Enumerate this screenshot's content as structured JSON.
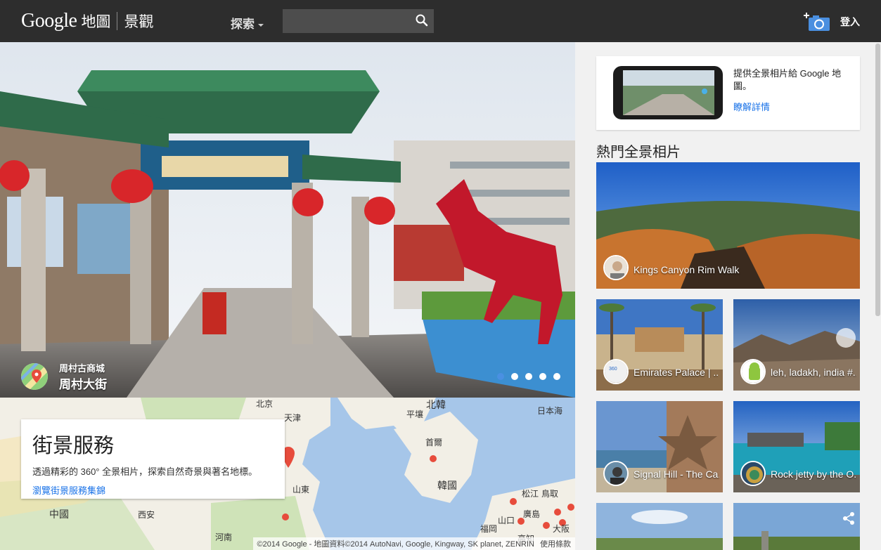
{
  "header": {
    "logo_google": "Google",
    "logo_maps": "地圖",
    "logo_views": "景觀",
    "explore_label": "探索",
    "search_placeholder": "",
    "signin_label": "登入"
  },
  "hero": {
    "place_sub": "周村古商城",
    "place_main": "周村大街",
    "slide_count": 5,
    "active_slide": 1
  },
  "map": {
    "card_title": "街景服務",
    "card_desc": "透過精彩的 360° 全景相片，探索自然奇景與著名地標。",
    "card_link": "瀏覽街景服務集錦",
    "labels": [
      "北京",
      "北韓",
      "平壤",
      "首爾",
      "韓國",
      "日本海",
      "中國",
      "西安",
      "山東",
      "河南",
      "松江",
      "福岡",
      "廣島",
      "山口",
      "大阪",
      "高知",
      "鳥取",
      "天津"
    ],
    "attribution": "©2014 Google - 地圖資料©2014 AutoNavi, Google, Kingway, SK planet, ZENRIN",
    "terms": "使用條款"
  },
  "promo": {
    "text": "提供全景相片給 Google 地圖。",
    "link": "瞭解詳情"
  },
  "popular": {
    "title": "熱門全景相片",
    "items": [
      {
        "caption": "Kings Canyon Rim Walk"
      },
      {
        "caption": "Emirates Palace | ..."
      },
      {
        "caption": "leh, ladakh, india #..."
      },
      {
        "caption": "Signal Hill - The Ca..."
      },
      {
        "caption": "Rock jetty by the O..."
      }
    ]
  },
  "colors": {
    "topbar": "#2d2d2d",
    "link": "#1a73e8",
    "active_dot": "#4a90e2",
    "marker": "#e74c3c"
  }
}
